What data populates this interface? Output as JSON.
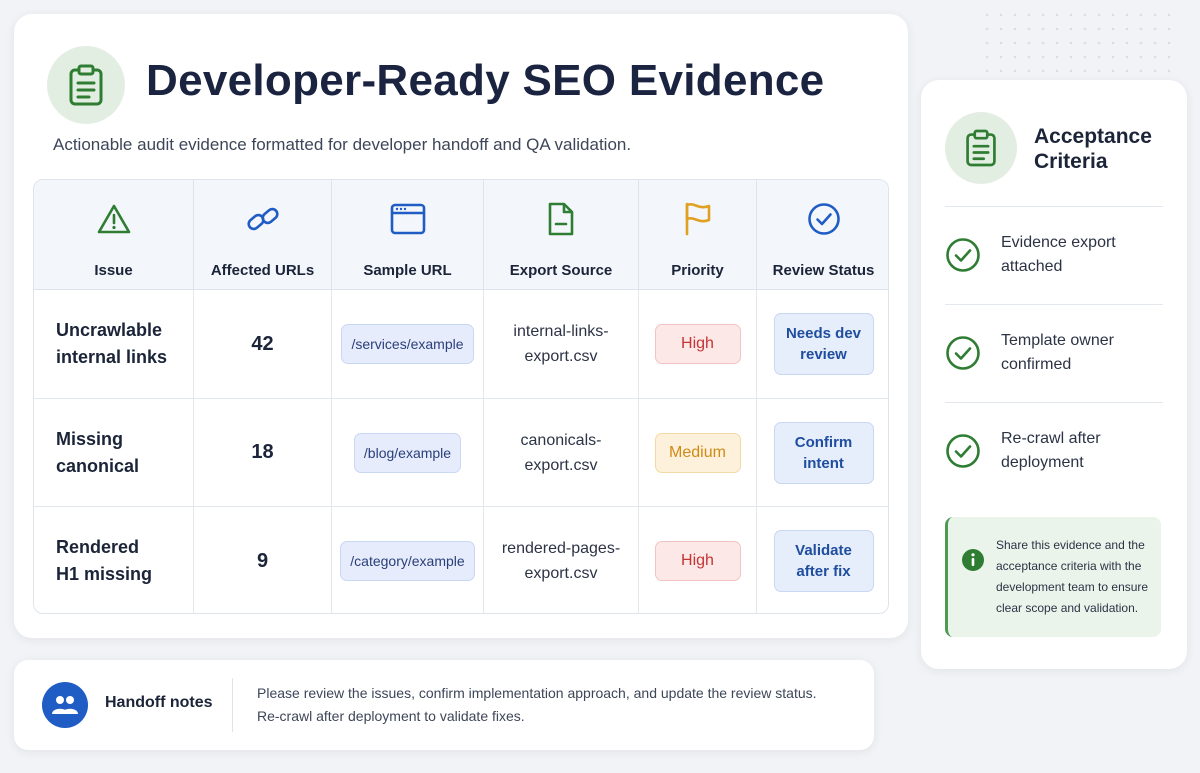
{
  "header": {
    "title": "Developer-Ready SEO Evidence",
    "subtitle": "Actionable audit evidence formatted for developer handoff and QA validation."
  },
  "table": {
    "columns": [
      {
        "label": "Issue",
        "icon": "warning-triangle-icon"
      },
      {
        "label": "Affected URLs",
        "icon": "link-icon"
      },
      {
        "label": "Sample URL",
        "icon": "browser-window-icon"
      },
      {
        "label": "Export Source",
        "icon": "document-icon"
      },
      {
        "label": "Priority",
        "icon": "flag-icon"
      },
      {
        "label": "Review Status",
        "icon": "check-circle-icon"
      }
    ],
    "rows": [
      {
        "issue_l1": "Uncrawlable",
        "issue_l2": "internal links",
        "count": "42",
        "url": "/services/example",
        "src_l1": "internal-links-",
        "src_l2": "export.csv",
        "priority": "High",
        "priority_level": "high",
        "status_l1": "Needs dev",
        "status_l2": "review"
      },
      {
        "issue_l1": "Missing",
        "issue_l2": "canonical",
        "count": "18",
        "url": "/blog/example",
        "src_l1": "canonicals-",
        "src_l2": "export.csv",
        "priority": "Medium",
        "priority_level": "medium",
        "status_l1": "Confirm",
        "status_l2": "intent"
      },
      {
        "issue_l1": "Rendered",
        "issue_l2": "H1 missing",
        "count": "9",
        "url": "/category/example",
        "src_l1": "rendered-pages-",
        "src_l2": "export.csv",
        "priority": "High",
        "priority_level": "high",
        "status_l1": "Validate",
        "status_l2": "after fix"
      }
    ]
  },
  "acceptance": {
    "title_l1": "Acceptance",
    "title_l2": "Criteria",
    "icon": "clipboard-icon",
    "items": [
      {
        "l1": "Evidence export",
        "l2": "attached"
      },
      {
        "l1": "Template owner",
        "l2": "confirmed"
      },
      {
        "l1": "Re-crawl after",
        "l2": "deployment"
      }
    ],
    "info": [
      "Share this evidence and the",
      "acceptance criteria with the",
      "development team to ensure",
      "clear scope and validation."
    ]
  },
  "notes": {
    "label": "Handoff notes",
    "icon": "users-icon",
    "line1": "Please review the issues, confirm implementation approach, and update the review status.",
    "line2": "Re-crawl after deployment to validate fixes."
  },
  "colors": {
    "green": "#2e7d32",
    "blue": "#1f5cc4",
    "high": "#c53434",
    "medium": "#d08a16"
  }
}
